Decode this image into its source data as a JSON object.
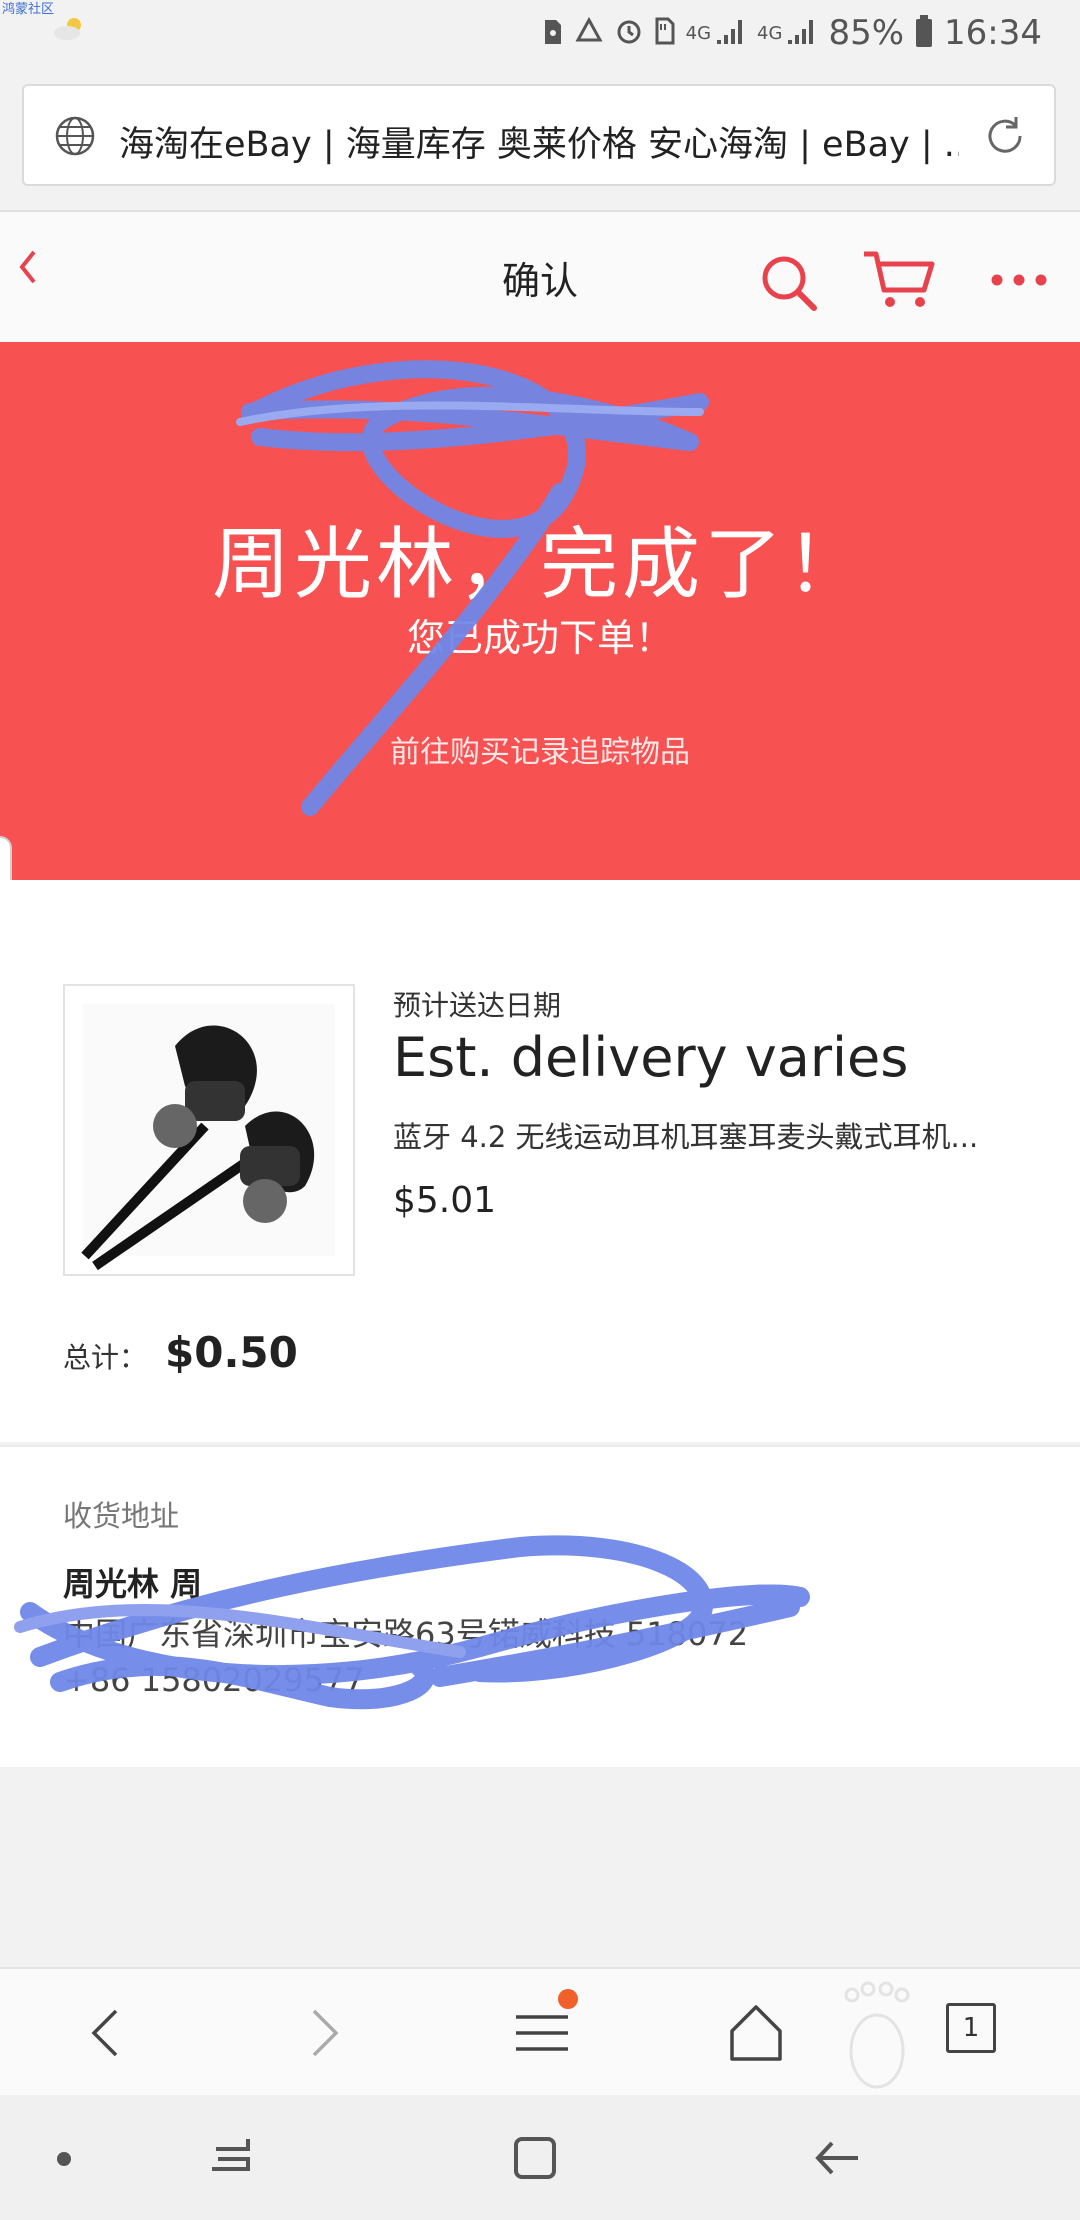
{
  "status_bar": {
    "tag": "鸿蒙社区",
    "network_1": "4G",
    "network_2": "4G",
    "battery": "85%",
    "time": "16:34"
  },
  "url_bar": {
    "title": "海淘在eBay | 海量库存 奥莱价格 安心海淘 | eBay | ..."
  },
  "header": {
    "title": "确认"
  },
  "banner": {
    "headline": "周光林，完成了！",
    "subtitle": "您已成功下单！",
    "link": "前往购买记录追踪物品"
  },
  "order": {
    "eta_label": "预计送达日期",
    "eta_value": "Est. delivery varies",
    "item_title": "蓝牙 4.2 无线运动耳机耳塞耳麦头戴式耳机...",
    "item_price": "$5.01",
    "total_label": "总计：",
    "total_value": "$0.50"
  },
  "address": {
    "label": "收货地址",
    "name": "周光林 周",
    "line1": "中国广东省深圳市宝安路63号锘威科技 518072",
    "line2": "+86 15802029577"
  },
  "browser_bar": {
    "tab_count": "1"
  },
  "colors": {
    "banner_red": "#f75151",
    "accent_red": "#e8434d",
    "scribble_blue": "#6f87e8",
    "badge_orange": "#f0602a"
  }
}
